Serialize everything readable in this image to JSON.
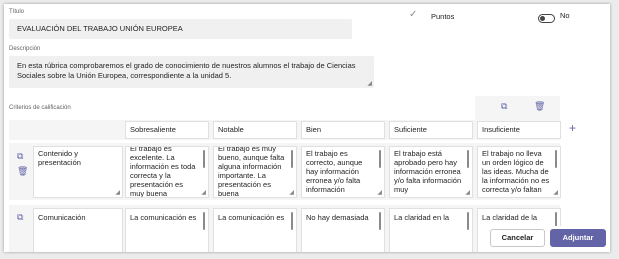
{
  "title_label": "Título",
  "title_value": "EVALUACIÓN DEL TRABAJO UNIÓN EUROPEA",
  "points_label": "Puntos",
  "points_toggle_value": "No",
  "description_label": "Descripción",
  "description_value": "En esta rúbrica comprobaremos el grado de conocimiento de nuestros alumnos el trabajo de Ciencias Sociales sobre la Unión Europea, correspondiente a la unidad 5.",
  "criteria_label": "Criterios de calificación",
  "levels": [
    "Sobresaliente",
    "Notable",
    "Bien",
    "Suficiente",
    "Insuficiente"
  ],
  "rows": [
    {
      "criterion": "Contenido y presentación",
      "cells": [
        "El trabajo es excelente. La información es toda correcta y la presentación es muy buena",
        "El trabajo es muy bueno, aunque falta alguna información importante. La presentación es buena",
        "El trabajo es correcto, aunque hay información erronea y/o falta información",
        "El trabajo está aprobado pero hay información erronea y/o falta información muy",
        "El trabajo no lleva un orden lógico de las ideas. Mucha de la información no es correcta y/o faltan"
      ]
    },
    {
      "criterion": "Comunicación",
      "cells": [
        "La comunicación es",
        "La comunicación es",
        "No hay demasiada",
        "La claridad en la",
        "La claridad de la"
      ]
    }
  ],
  "buttons": {
    "cancel": "Cancelar",
    "attach": "Adjuntar"
  },
  "colors": {
    "accent": "#6264a7",
    "field_bg": "#f0f0f0"
  },
  "icons": {
    "check": "checkmark-icon",
    "copy": "copy-icon",
    "delete": "trash-icon",
    "add": "plus-icon"
  }
}
